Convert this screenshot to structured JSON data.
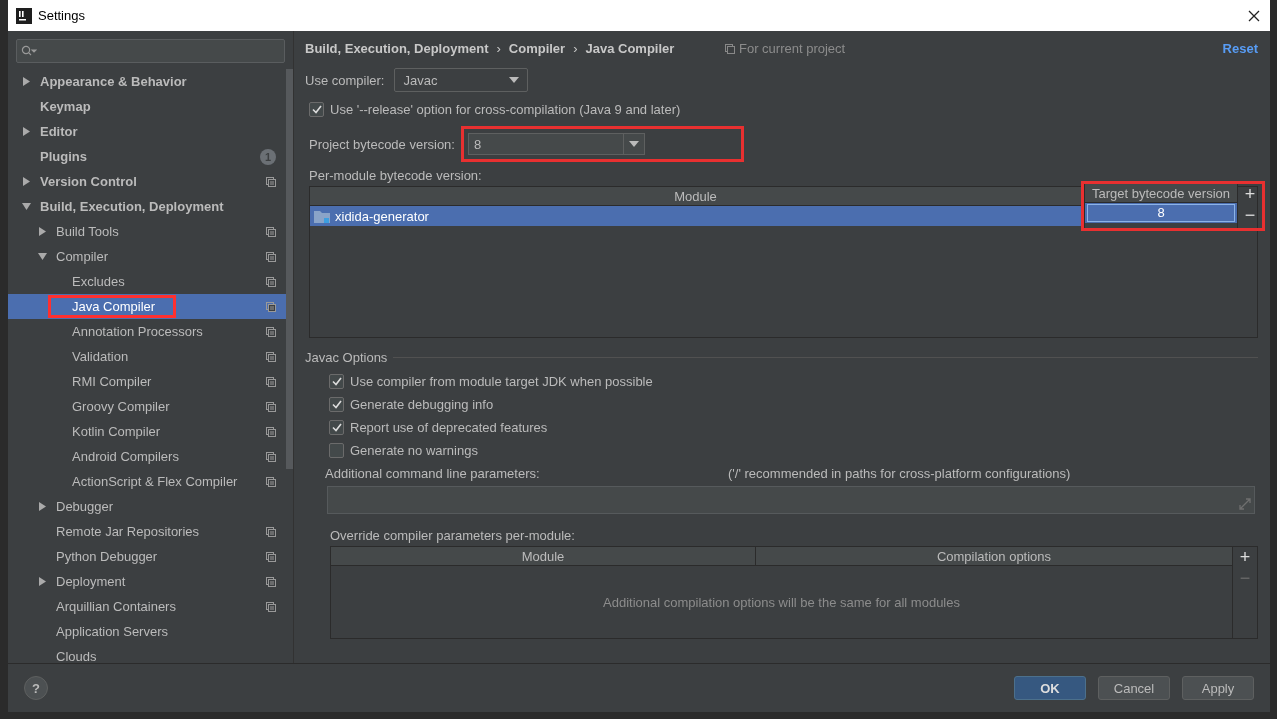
{
  "window": {
    "title": "Settings"
  },
  "sidebar": {
    "items": [
      {
        "label": "Appearance & Behavior",
        "expanded": false,
        "selected": false,
        "highlighted": false,
        "project_level": false
      },
      {
        "label": "Keymap",
        "selected": false,
        "highlighted": false,
        "project_level": false
      },
      {
        "label": "Editor",
        "expanded": false,
        "selected": false,
        "highlighted": false,
        "project_level": false
      },
      {
        "label": "Plugins",
        "selected": false,
        "highlighted": false,
        "project_level": false,
        "badge": "1"
      },
      {
        "label": "Version Control",
        "expanded": false,
        "selected": false,
        "highlighted": false,
        "project_level": true
      },
      {
        "label": "Build, Execution, Deployment",
        "expanded": true,
        "selected": false,
        "highlighted": false,
        "project_level": false,
        "children": [
          {
            "label": "Build Tools",
            "expanded": false,
            "selected": false,
            "highlighted": false,
            "project_level": true
          },
          {
            "label": "Compiler",
            "expanded": true,
            "selected": false,
            "highlighted": false,
            "project_level": true,
            "children": [
              {
                "label": "Excludes",
                "selected": false,
                "highlighted": false,
                "project_level": true
              },
              {
                "label": "Java Compiler",
                "selected": true,
                "highlighted": true,
                "project_level": true
              },
              {
                "label": "Annotation Processors",
                "selected": false,
                "highlighted": false,
                "project_level": true
              },
              {
                "label": "Validation",
                "selected": false,
                "highlighted": false,
                "project_level": true
              },
              {
                "label": "RMI Compiler",
                "selected": false,
                "highlighted": false,
                "project_level": true
              },
              {
                "label": "Groovy Compiler",
                "selected": false,
                "highlighted": false,
                "project_level": true
              },
              {
                "label": "Kotlin Compiler",
                "selected": false,
                "highlighted": false,
                "project_level": true
              },
              {
                "label": "Android Compilers",
                "selected": false,
                "highlighted": false,
                "project_level": true
              },
              {
                "label": "ActionScript & Flex Compiler",
                "selected": false,
                "highlighted": false,
                "project_level": true
              }
            ]
          },
          {
            "label": "Debugger",
            "expanded": false,
            "selected": false,
            "highlighted": false,
            "project_level": false
          },
          {
            "label": "Remote Jar Repositories",
            "selected": false,
            "highlighted": false,
            "project_level": true
          },
          {
            "label": "Python Debugger",
            "selected": false,
            "highlighted": false,
            "project_level": true
          },
          {
            "label": "Deployment",
            "expanded": false,
            "selected": false,
            "highlighted": false,
            "project_level": true
          },
          {
            "label": "Arquillian Containers",
            "selected": false,
            "highlighted": false,
            "project_level": true
          },
          {
            "label": "Application Servers",
            "selected": false,
            "highlighted": false,
            "project_level": false
          },
          {
            "label": "Clouds",
            "selected": false,
            "highlighted": false,
            "project_level": false
          }
        ]
      }
    ]
  },
  "breadcrumb": {
    "parts": [
      "Build, Execution, Deployment",
      "Compiler",
      "Java Compiler"
    ],
    "separator": "›"
  },
  "scope": "For current project",
  "reset": "Reset",
  "use_compiler": {
    "label": "Use compiler:",
    "value": "Javac"
  },
  "release_option": {
    "label": "Use '--release' option for cross-compilation (Java 9 and later)",
    "checked": true
  },
  "project_bytecode": {
    "label": "Project bytecode version:",
    "value": "8",
    "highlighted": true
  },
  "per_module": {
    "label": "Per-module bytecode version:",
    "columns": [
      "Module",
      "Target bytecode version"
    ],
    "target_column_highlighted": true,
    "rows": [
      {
        "module": "xidida-generator",
        "target": "8",
        "selected": true
      }
    ],
    "buttons": [
      {
        "label": "+",
        "disabled": false
      },
      {
        "label": "−",
        "disabled": false
      }
    ]
  },
  "javac_options": {
    "title": "Javac Options",
    "checkboxes": [
      {
        "label": "Use compiler from module target JDK when possible",
        "checked": true
      },
      {
        "label": "Generate debugging info",
        "checked": true
      },
      {
        "label": "Report use of deprecated features",
        "checked": true
      },
      {
        "label": "Generate no warnings",
        "checked": false
      }
    ],
    "params": {
      "label": "Additional command line parameters:",
      "hint": "('/' recommended in paths for cross-platform configurations)"
    },
    "override": {
      "label": "Override compiler parameters per-module:",
      "columns": [
        "Module",
        "Compilation options"
      ],
      "empty_text": "Additional compilation options will be the same for all modules",
      "buttons": [
        {
          "label": "+",
          "disabled": false
        },
        {
          "label": "−",
          "disabled": true
        }
      ]
    }
  },
  "footer": {
    "help": "?",
    "buttons": [
      {
        "label": "OK",
        "default": true
      },
      {
        "label": "Cancel",
        "default": false
      },
      {
        "label": "Apply",
        "default": false
      }
    ]
  }
}
